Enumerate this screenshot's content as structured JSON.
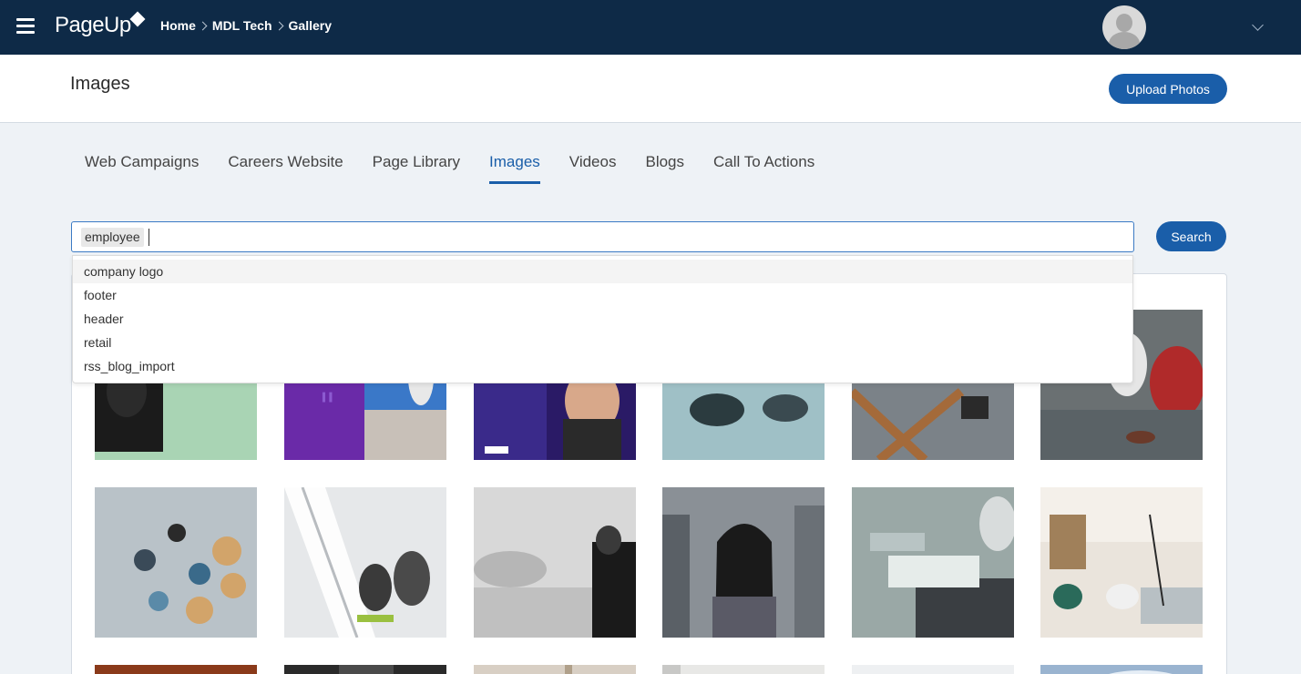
{
  "app": {
    "logo_text": "PageUp"
  },
  "breadcrumb": {
    "items": [
      "Home",
      "MDL Tech"
    ],
    "current": "Gallery"
  },
  "header": {
    "title": "Images",
    "upload_label": "Upload Photos"
  },
  "tabs": [
    {
      "label": "Web Campaigns",
      "active": false
    },
    {
      "label": "Careers Website",
      "active": false
    },
    {
      "label": "Page Library",
      "active": false
    },
    {
      "label": "Images",
      "active": true
    },
    {
      "label": "Videos",
      "active": false
    },
    {
      "label": "Blogs",
      "active": false
    },
    {
      "label": "Call To Actions",
      "active": false
    }
  ],
  "search": {
    "tags": [
      "employee"
    ],
    "button_label": "Search"
  },
  "dropdown": {
    "items": [
      "company logo",
      "footer",
      "header",
      "retail",
      "rss_blog_import"
    ]
  },
  "colors": {
    "topbar": "#0e2a47",
    "accent": "#1a5ea9",
    "page_bg": "#eef2f6"
  }
}
